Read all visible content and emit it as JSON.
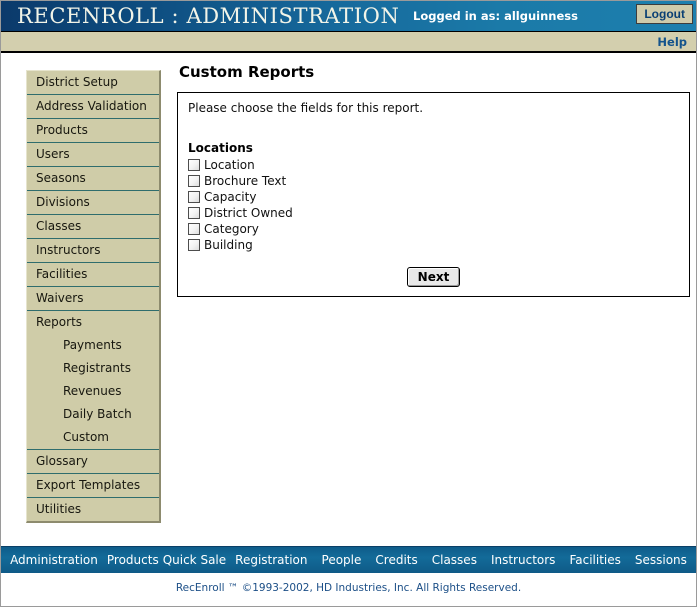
{
  "header": {
    "app_title": "RECENROLL : ADMINISTRATION",
    "login_status": "Logged in as: allguinness",
    "logout_label": "Logout",
    "help_label": "Help",
    "colors": {
      "header_start": "#0b3a6b",
      "header_end": "#1d7fae",
      "help_bar": "#d3cfae",
      "sidebar": "#cfcca8",
      "link_blue": "#14548c"
    }
  },
  "sidebar": {
    "items": [
      {
        "label": "District Setup"
      },
      {
        "label": "Address Validation"
      },
      {
        "label": "Products"
      },
      {
        "label": "Users"
      },
      {
        "label": "Seasons"
      },
      {
        "label": "Divisions"
      },
      {
        "label": "Classes"
      },
      {
        "label": "Instructors"
      },
      {
        "label": "Facilities"
      },
      {
        "label": "Waivers"
      },
      {
        "label": "Reports"
      }
    ],
    "reports_subitems": [
      {
        "label": "Payments"
      },
      {
        "label": "Registrants"
      },
      {
        "label": "Revenues"
      },
      {
        "label": "Daily Batch"
      },
      {
        "label": "Custom"
      }
    ],
    "trailing_items": [
      {
        "label": "Glossary"
      },
      {
        "label": "Export Templates"
      },
      {
        "label": "Utilities"
      }
    ]
  },
  "main": {
    "page_title": "Custom Reports",
    "intro": "Please choose the fields for this report.",
    "group_title": "Locations",
    "fields": [
      {
        "label": "Location",
        "checked": false
      },
      {
        "label": "Brochure Text",
        "checked": false
      },
      {
        "label": "Capacity",
        "checked": false
      },
      {
        "label": "District Owned",
        "checked": false
      },
      {
        "label": "Category",
        "checked": false
      },
      {
        "label": "Building",
        "checked": false
      }
    ],
    "next_label": "Next"
  },
  "footer": {
    "links": [
      {
        "label": "Administration"
      },
      {
        "label": "Products"
      },
      {
        "label": "Quick Sale"
      },
      {
        "label": "Registration"
      },
      {
        "label": "People"
      },
      {
        "label": "Credits"
      },
      {
        "label": "Classes"
      },
      {
        "label": "Instructors"
      },
      {
        "label": "Facilities"
      },
      {
        "label": "Sessions"
      }
    ],
    "copyright": "RecEnroll ™ ©1993-2002,  HD Industries, Inc.  All Rights Reserved."
  }
}
